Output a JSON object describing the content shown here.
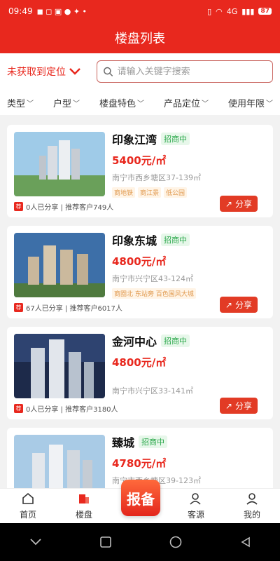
{
  "status_bar": {
    "time": "09:49",
    "network": "4G",
    "battery": "87"
  },
  "header": {
    "title": "楼盘列表"
  },
  "search": {
    "location_label": "未获取到定位",
    "placeholder": "请输入关键字搜索"
  },
  "filters": [
    {
      "label": "类型"
    },
    {
      "label": "户型"
    },
    {
      "label": "楼盘特色"
    },
    {
      "label": "产品定位"
    },
    {
      "label": "使用年限"
    }
  ],
  "listings": [
    {
      "name": "印象江湾",
      "status": "招商中",
      "price": "5400元/㎡",
      "address": "南宁市西乡塘区37-139㎡",
      "tags": [
        "商地铁",
        "商江景",
        "低公园"
      ],
      "share_text": "0人已分享 | 推荐客户749人",
      "share_button": "分享"
    },
    {
      "name": "印象东城",
      "status": "招商中",
      "price": "4800元/㎡",
      "address": "南宁市兴宁区43-124㎡",
      "tags": [
        "商圈北 东站旁 百色国风大城"
      ],
      "share_text": "67人已分享 | 推荐客户6017人",
      "share_button": "分享"
    },
    {
      "name": "金河中心",
      "status": "招商中",
      "price": "4800元/㎡",
      "address": "南宁市兴宁区33-141㎡",
      "tags": [],
      "share_text": "0人已分享 | 推荐客户3180人",
      "share_button": "分享"
    },
    {
      "name": "臻城",
      "status": "招商中",
      "price": "4780元/㎡",
      "address": "南宁市西乡塘区39-123㎡",
      "tags": [],
      "share_text": "",
      "share_button": ""
    }
  ],
  "tabbar": {
    "home": "首页",
    "listings": "楼盘",
    "report": "报备",
    "clients": "客源",
    "mine": "我的"
  },
  "colors": {
    "brand_red": "#e8281e",
    "status_green": "#2aa84a"
  }
}
